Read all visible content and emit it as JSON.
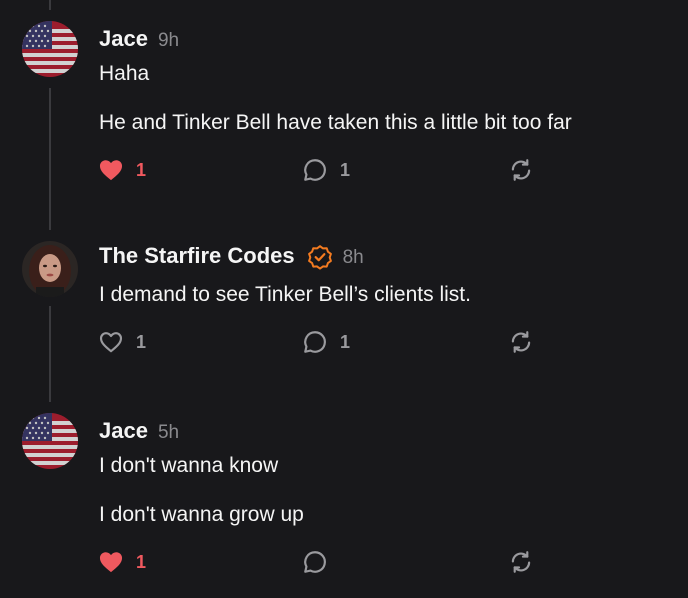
{
  "colors": {
    "background": "#18181b",
    "text": "#f5f5f5",
    "muted": "#8a8a8e",
    "like": "#f0595f",
    "verified": "#f47b20",
    "icon": "#9a9a9e"
  },
  "posts": [
    {
      "author": "Jace",
      "time": "9h",
      "avatar_icon": "us-flag-avatar",
      "lines": [
        "Haha",
        "He and Tinker Bell have taken this a little bit too far"
      ],
      "liked": true,
      "like_count": "1",
      "reply_count": "1"
    },
    {
      "author": "The Starfire Codes",
      "time": "8h",
      "verified": true,
      "avatar_icon": "profile-photo-avatar",
      "lines": [
        "I demand to see Tinker Bell’s clients list."
      ],
      "liked": false,
      "like_count": "1",
      "reply_count": "1"
    },
    {
      "author": "Jace",
      "time": "5h",
      "avatar_icon": "us-flag-avatar",
      "lines": [
        "I don't wanna know",
        "I don't wanna grow up"
      ],
      "liked": true,
      "like_count": "1",
      "reply_count": ""
    }
  ]
}
